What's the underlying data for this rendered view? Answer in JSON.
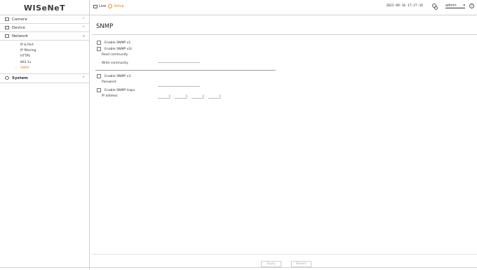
{
  "header": {
    "logo": "WISeNeT",
    "nav": {
      "live_label": "Live",
      "setup_label": "Setup"
    },
    "datetime": "2022-09-16 17:27:16",
    "user": {
      "value": "admin",
      "caret": "▾"
    },
    "help_label": "?"
  },
  "sidebar": {
    "categories": [
      {
        "label": "Camera",
        "icon": "camera-icon",
        "chevron": "^"
      },
      {
        "label": "Device",
        "icon": "device-icon",
        "chevron": "^"
      },
      {
        "label": "Network",
        "icon": "network-icon",
        "chevron": "v"
      }
    ],
    "network_items": [
      {
        "label": "IP & Port"
      },
      {
        "label": "IP filtering"
      },
      {
        "label": "HTTPS"
      },
      {
        "label": "802.1x"
      },
      {
        "label": "SNMP"
      }
    ],
    "system": {
      "label": "System",
      "icon": "gear-icon",
      "chevron": "^"
    }
  },
  "main": {
    "title": "SNMP",
    "snmp_v1_label": "Enable SNMP v1",
    "snmp_v2c_label": "Enable SNMP v2c",
    "read_community_label": "Read community",
    "write_community_label": "Write community",
    "snmp_v3_label": "Enable SNMP v3",
    "password_label": "Password",
    "snmp_traps_label": "Enable SNMP traps",
    "ip_address_label": "IP address",
    "ip_address": [
      "0",
      "0",
      "0",
      "0"
    ],
    "apply_label": "Apply",
    "revert_label": "Revert"
  },
  "colors": {
    "accent": "#e08a1e",
    "border": "#cfcfcf"
  }
}
